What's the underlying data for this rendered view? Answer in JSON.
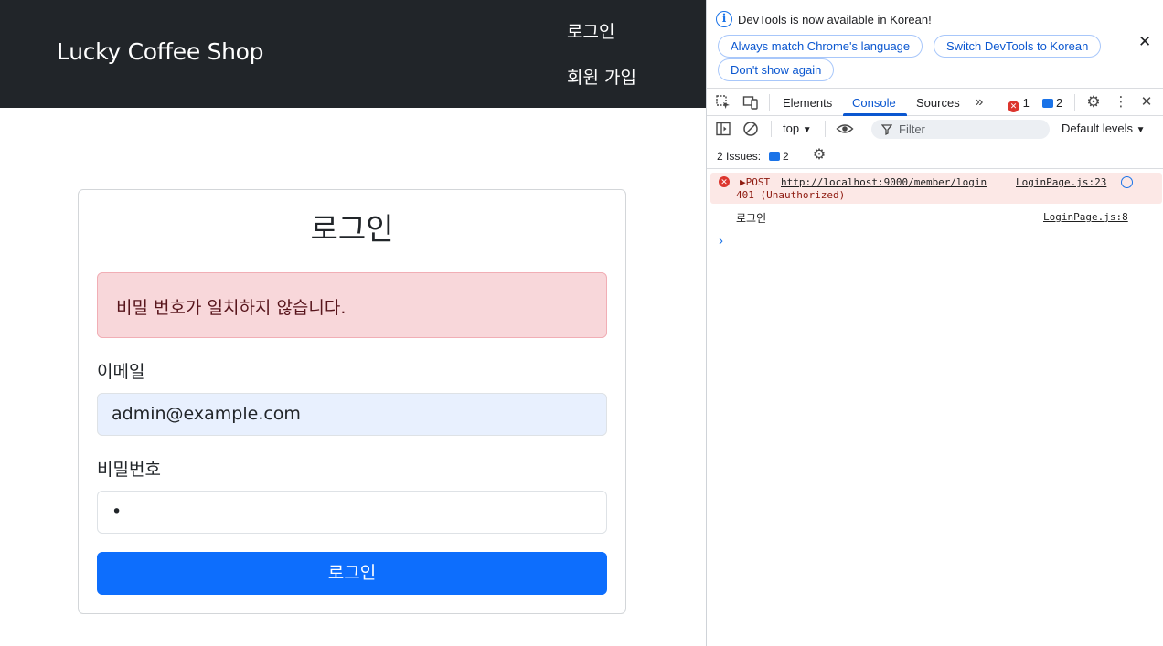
{
  "app": {
    "brand": "Lucky Coffee Shop",
    "nav": {
      "login": "로그인",
      "signup": "회원 가입"
    },
    "form": {
      "title": "로그인",
      "alert": "비밀 번호가 일치하지 않습니다.",
      "email_label": "이메일",
      "email_value": "admin@example.com",
      "password_label": "비밀번호",
      "password_value": "•",
      "submit_label": "로그인"
    }
  },
  "devtools": {
    "info_text": "DevTools is now available in Korean!",
    "info_buttons": [
      "Always match Chrome's language",
      "Switch DevTools to Korean",
      "Don't show again"
    ],
    "tabs": [
      "Elements",
      "Console",
      "Sources"
    ],
    "active_tab": "Console",
    "error_count": "1",
    "message_count": "2",
    "context": "top",
    "filter_placeholder": "Filter",
    "levels": "Default levels",
    "issues_label": "2 Issues:",
    "issues_count": "2",
    "logs": [
      {
        "method": "▶POST",
        "url": "http://localhost:9000/member/login",
        "status": "401 (Unauthorized)",
        "source": "LoginPage.js:23"
      },
      {
        "text": "로그인",
        "source": "LoginPage.js:8"
      }
    ],
    "colors": {
      "accent": "#0b57d0",
      "error": "#dc362e",
      "primary_button": "#0d6efd",
      "navbar": "#212529"
    }
  }
}
